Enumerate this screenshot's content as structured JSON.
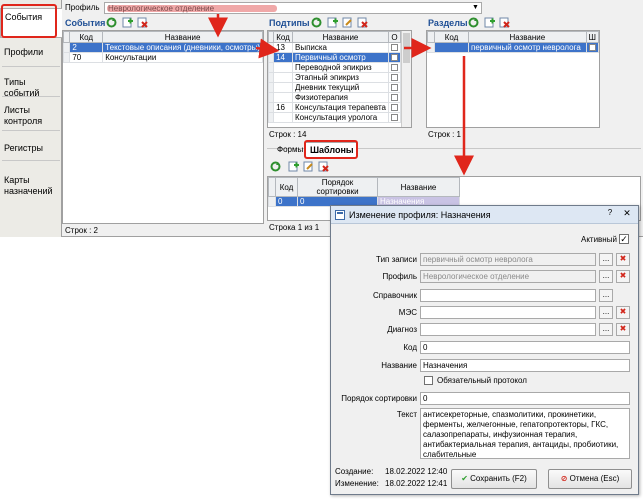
{
  "left_tabs": [
    "События",
    "Профили",
    "Типы событий",
    "Листы контроля",
    "Регистры",
    "Карты назначений"
  ],
  "profile": {
    "label": "Профиль",
    "value": "Неврологическое отделение"
  },
  "events_panel": {
    "title": "События",
    "columns": [
      "Код",
      "Название"
    ],
    "rows": [
      {
        "code": "2",
        "name": "Текстовые описания (дневники, осмотры)",
        "selected": true
      },
      {
        "code": "70",
        "name": "Консультации",
        "selected": false
      }
    ],
    "footer": "Строк : 2"
  },
  "subtypes_panel": {
    "title": "Подтипы",
    "columns": [
      "Код",
      "Название",
      "О"
    ],
    "rows": [
      {
        "code": "13",
        "name": "Выписка",
        "selected": false
      },
      {
        "code": "14",
        "name": "Первичный осмотр",
        "selected": true
      },
      {
        "code": "",
        "name": "Переводной эпикриз",
        "selected": false
      },
      {
        "code": "",
        "name": "Этапный эпикриз",
        "selected": false
      },
      {
        "code": "",
        "name": "Дневник текущий",
        "selected": false
      },
      {
        "code": "",
        "name": "Физиотерапия",
        "selected": false
      },
      {
        "code": "16",
        "name": "Консультация терапевта",
        "selected": false
      },
      {
        "code": "",
        "name": "Консультация уролога",
        "selected": false
      }
    ],
    "footer": "Строк : 14"
  },
  "sections_panel": {
    "title": "Разделы",
    "columns": [
      "Код",
      "Название",
      "Ш"
    ],
    "rows": [
      {
        "code": "",
        "name": "первичный осмотр невролога",
        "selected": true
      }
    ],
    "footer": "Строк : 1"
  },
  "bottom_tabs": [
    "Формы",
    "Шаблоны"
  ],
  "templates_panel": {
    "columns": [
      "Код",
      "Порядок сортировки",
      "Название"
    ],
    "rows": [
      {
        "code": "0",
        "order": "0",
        "name": "Назначения",
        "selected": true
      }
    ],
    "footer": "Строка 1 из 1"
  },
  "dialog": {
    "title": "Изменение профиля: Назначения",
    "active_label": "Активный",
    "active_checked": true,
    "fields": {
      "record_type": {
        "label": "Тип записи",
        "value": "первичный осмотр невролога"
      },
      "profile": {
        "label": "Профиль",
        "value": "Неврологическое отделение"
      },
      "reference": {
        "label": "Справочник",
        "value": ""
      },
      "mes": {
        "label": "МЭС",
        "value": ""
      },
      "diagnosis": {
        "label": "Диагноз",
        "value": ""
      },
      "code": {
        "label": "Код",
        "value": "0"
      },
      "name": {
        "label": "Название",
        "value": "Назначения"
      },
      "mandatory_protocol": {
        "label": "Обязательный протокол",
        "checked": false
      },
      "sort_order": {
        "label": "Порядок сортировки",
        "value": "0"
      },
      "text": {
        "label": "Текст",
        "lines": [
          "антисекреторные, спазмолитики, прокинетики,",
          "ферменты, желчегонные, гепатопротекторы, ГКС,",
          "салазопрепараты, инфузионная терапия,",
          "антибактериальная терапия, антациды, пробиотики,",
          "слабительные"
        ]
      }
    },
    "created": {
      "label": "Создание:",
      "value": "18.02.2022 12:40"
    },
    "modified": {
      "label": "Изменение:",
      "value": "18.02.2022 12:41"
    },
    "save_button": "Сохранить (F2)",
    "cancel_button": "Отмена (Esc)",
    "ellipsis": "...",
    "clear": "✖",
    "close_glyph": "✕",
    "help_glyph": "?"
  },
  "colors": {
    "accent_red": "#e0261b",
    "selection_blue": "#3d73c9",
    "title_blue": "#1f4f95"
  }
}
